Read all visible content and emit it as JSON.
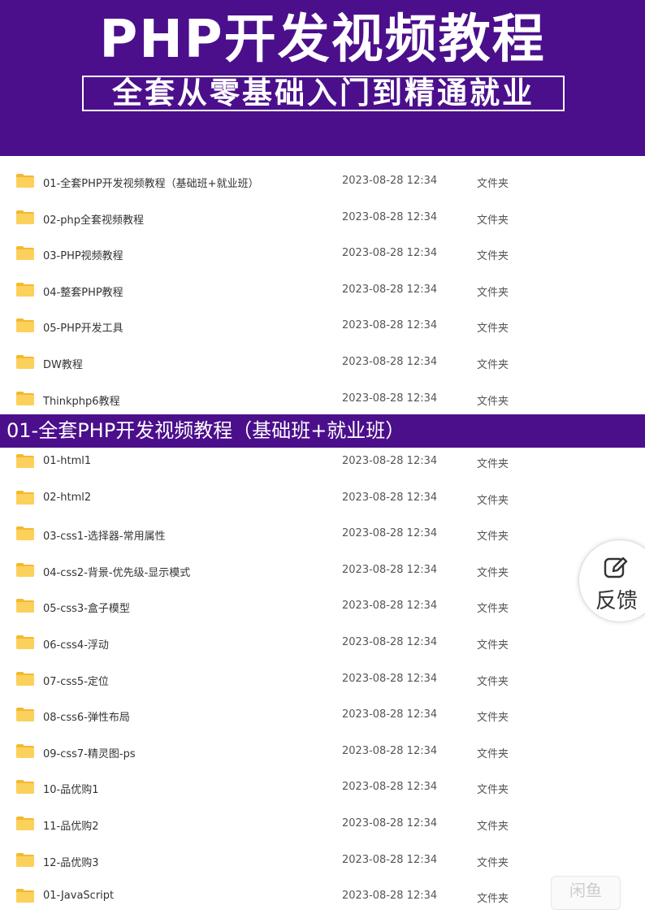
{
  "banner": {
    "title": "PHP开发视频教程",
    "subtitle": "全套从零基础入门到精通就业"
  },
  "top_list": [
    {
      "name": "01-全套PHP开发视频教程（基础班+就业班）",
      "date": "2023-08-28 12:34",
      "type": "文件夹"
    },
    {
      "name": "02-php全套视频教程",
      "date": "2023-08-28 12:34",
      "type": "文件夹"
    },
    {
      "name": "03-PHP视频教程",
      "date": "2023-08-28 12:34",
      "type": "文件夹"
    },
    {
      "name": "04-整套PHP教程",
      "date": "2023-08-28 12:34",
      "type": "文件夹"
    },
    {
      "name": "05-PHP开发工具",
      "date": "2023-08-28 12:34",
      "type": "文件夹"
    },
    {
      "name": "DW教程",
      "date": "2023-08-28 12:34",
      "type": "文件夹"
    },
    {
      "name": "Thinkphp6教程",
      "date": "2023-08-28 12:34",
      "type": "文件夹"
    }
  ],
  "section": {
    "title": "01-全套PHP开发视频教程（基础班+就业班）"
  },
  "sub_list": [
    {
      "name": "01-html1",
      "date": "2023-08-28 12:34",
      "type": "文件夹"
    },
    {
      "name": "02-html2",
      "date": "2023-08-28 12:34",
      "type": "文件夹"
    },
    {
      "name": "03-css1-选择器-常用属性",
      "date": "2023-08-28 12:34",
      "type": "文件夹"
    },
    {
      "name": "04-css2-背景-优先级-显示模式",
      "date": "2023-08-28 12:34",
      "type": "文件夹"
    },
    {
      "name": "05-css3-盒子模型",
      "date": "2023-08-28 12:34",
      "type": "文件夹"
    },
    {
      "name": "06-css4-浮动",
      "date": "2023-08-28 12:34",
      "type": "文件夹"
    },
    {
      "name": "07-css5-定位",
      "date": "2023-08-28 12:34",
      "type": "文件夹"
    },
    {
      "name": "08-css6-弹性布局",
      "date": "2023-08-28 12:34",
      "type": "文件夹"
    },
    {
      "name": "09-css7-精灵图-ps",
      "date": "2023-08-28 12:34",
      "type": "文件夹"
    },
    {
      "name": "10-品优购1",
      "date": "2023-08-28 12:34",
      "type": "文件夹"
    },
    {
      "name": "11-品优购2",
      "date": "2023-08-28 12:34",
      "type": "文件夹"
    },
    {
      "name": "12-品优购3",
      "date": "2023-08-28 12:34",
      "type": "文件夹"
    },
    {
      "name": "01-JavaScript",
      "date": "2023-08-28 12:34",
      "type": "文件夹"
    }
  ],
  "feedback": {
    "label": "反馈",
    "icon": "edit-icon"
  },
  "corner_badge": {
    "label": "闲鱼"
  },
  "colors": {
    "banner_bg": "#4b0f8c",
    "folder_yellow": "#f7c843"
  }
}
